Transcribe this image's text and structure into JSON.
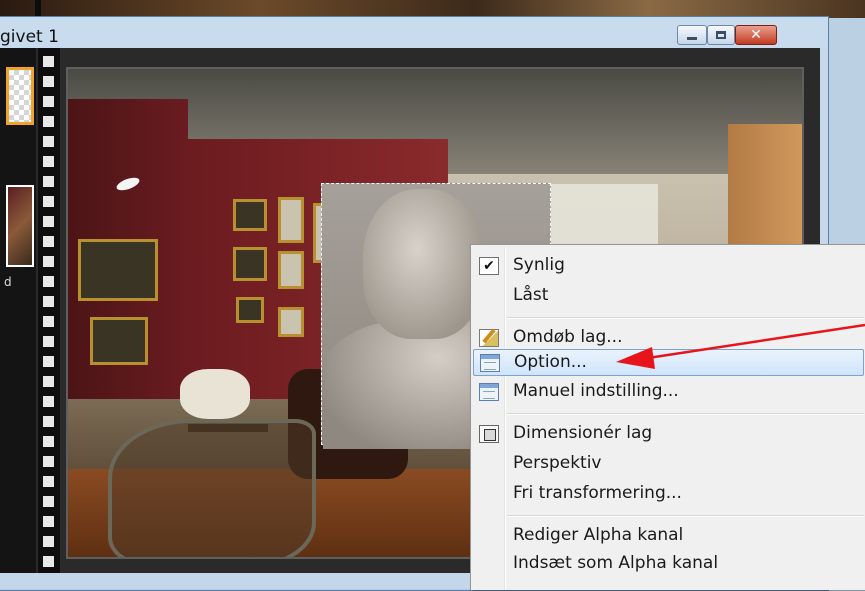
{
  "window": {
    "title": "givet 1",
    "buttons": {
      "minimize": "minimize",
      "maximize": "maximize",
      "close": "close"
    }
  },
  "layers": {
    "thumb_label": "d"
  },
  "context_menu": {
    "items": [
      {
        "label": "Synlig",
        "icon": "checkbox-checked-icon",
        "checked": true
      },
      {
        "label": "Låst",
        "icon": ""
      },
      {
        "label": "Omdøb lag...",
        "icon": "rename-icon"
      },
      {
        "label": "Option...",
        "icon": "options-window-icon",
        "highlighted": true
      },
      {
        "label": "Manuel indstilling...",
        "icon": "manual-settings-icon"
      },
      {
        "label": "Dimensionér lag",
        "icon": "resize-layer-icon"
      },
      {
        "label": "Perspektiv",
        "icon": ""
      },
      {
        "label": "Fri transformering...",
        "icon": ""
      },
      {
        "label": "Rediger Alpha kanal",
        "icon": ""
      },
      {
        "label": "Indsæt som Alpha kanal",
        "icon": ""
      }
    ]
  },
  "colors": {
    "highlight_border": "#7da2ce",
    "arrow": "#e8141b",
    "selected_thumb_border": "#f0a32a"
  }
}
